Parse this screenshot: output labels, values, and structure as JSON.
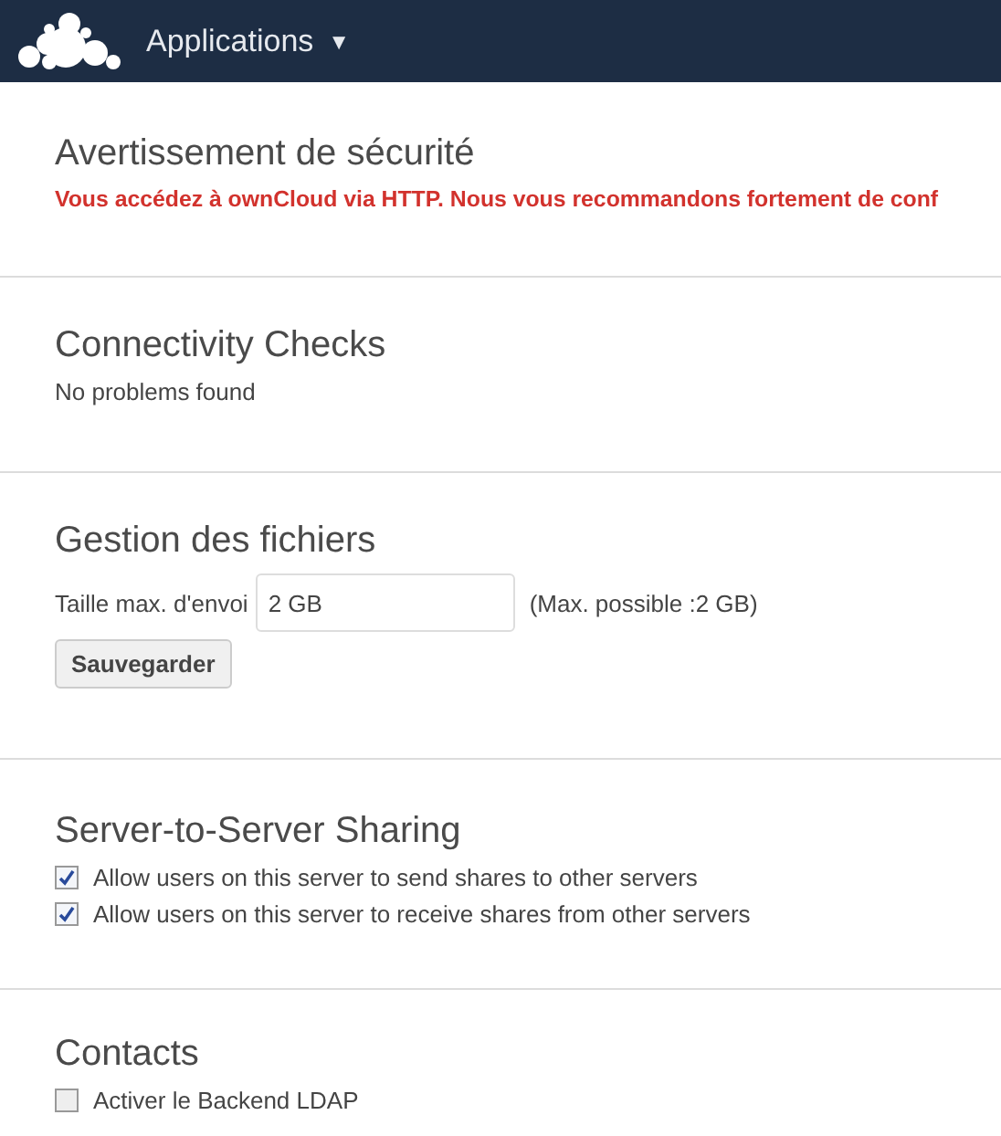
{
  "header": {
    "menu_label": "Applications",
    "menu_caret": "▼"
  },
  "sections": [
    {
      "kind": "warning",
      "title": "Avertissement de sécurité",
      "text": "Vous accédez à ownCloud via HTTP. Nous vous recommandons fortement de conf"
    },
    {
      "kind": "note",
      "title": "Connectivity Checks",
      "text": "No problems found"
    },
    {
      "kind": "upload",
      "title": "Gestion des fichiers",
      "label": "Taille max. d'envoi",
      "value": "2 GB",
      "hint": "(Max. possible :2 GB)",
      "button": "Sauvegarder"
    },
    {
      "kind": "checks",
      "title": "Server-to-Server Sharing",
      "options": [
        {
          "label": "Allow users on this server to send shares to other servers",
          "checked": true
        },
        {
          "label": "Allow users on this server to receive shares from other servers",
          "checked": true
        }
      ]
    },
    {
      "kind": "checks",
      "title": "Contacts",
      "options": [
        {
          "label": "Activer le Backend LDAP",
          "checked": false
        }
      ]
    }
  ]
}
